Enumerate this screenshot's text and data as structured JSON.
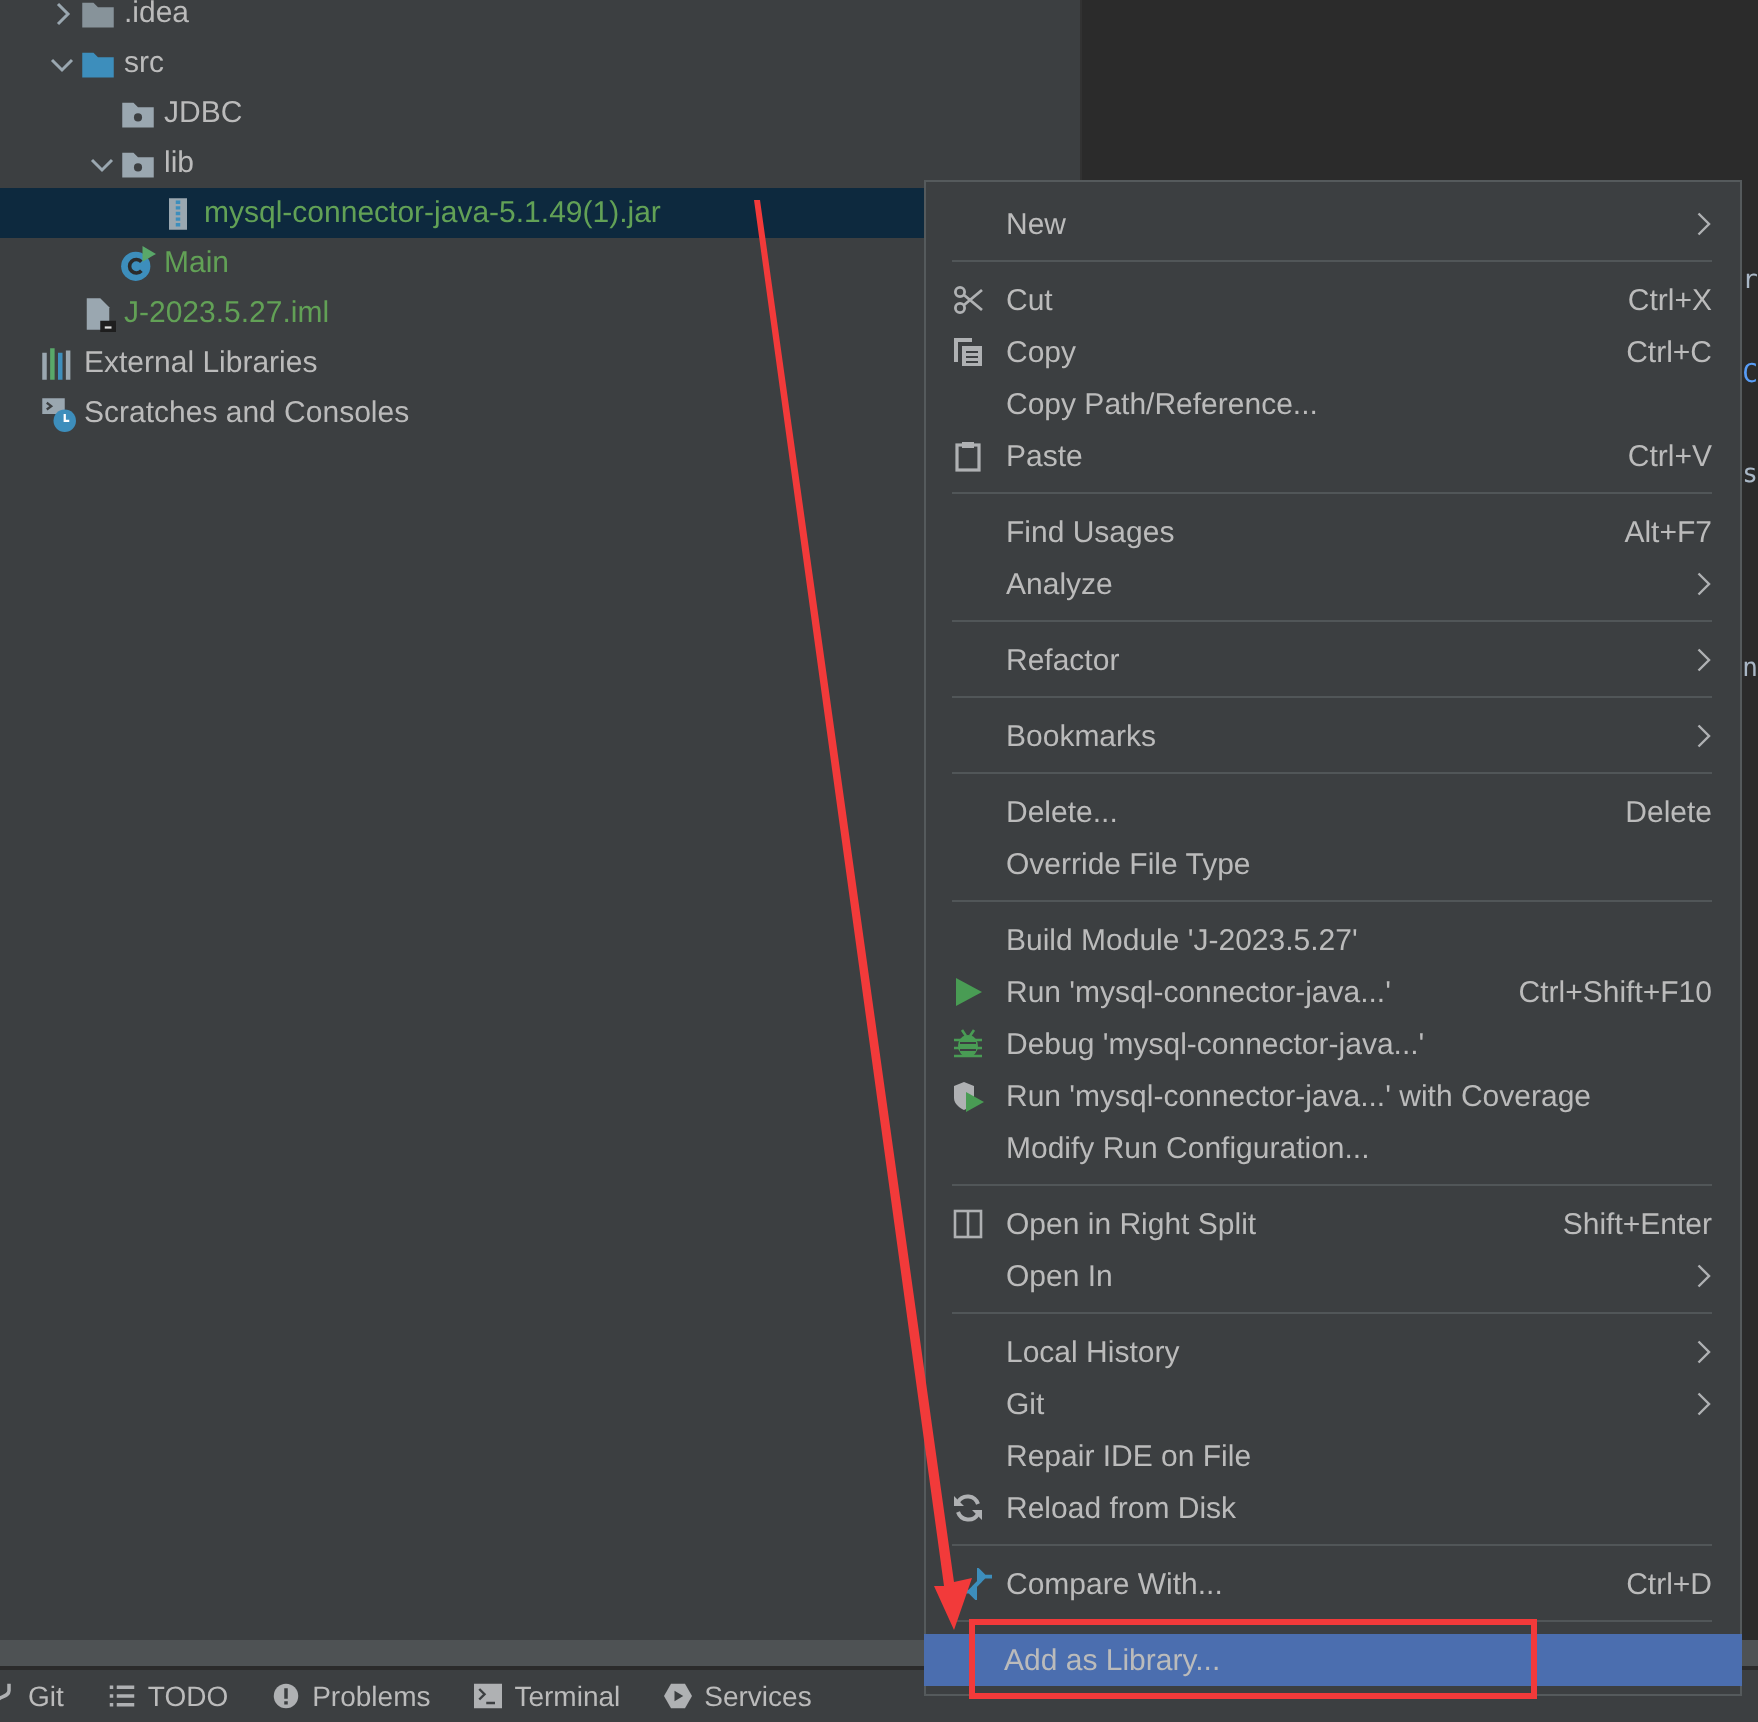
{
  "project_tree": [
    {
      "children": [
        {
          "label": ".idea",
          "kind": "folder",
          "expanded": false,
          "color": "#bbbbbb",
          "selected": false
        },
        {
          "label": "src",
          "kind": "source-root",
          "expanded": true,
          "color": "#bbbbbb",
          "selected": false,
          "children": [
            {
              "label": "JDBC",
              "kind": "package",
              "color": "#bbbbbb",
              "selected": false
            },
            {
              "label": "lib",
              "kind": "package",
              "expanded": true,
              "color": "#bbbbbb",
              "selected": false,
              "children": [
                {
                  "label": "mysql-connector-java-5.1.49(1).jar",
                  "kind": "jar",
                  "color": "#62a156",
                  "selected": true
                }
              ]
            },
            {
              "label": "Main",
              "kind": "class",
              "color": "#62a156",
              "selected": false
            }
          ]
        },
        {
          "label": "J-2023.5.27.iml",
          "kind": "module-file",
          "color": "#62a156",
          "selected": false
        }
      ]
    },
    {
      "label": "External Libraries",
      "kind": "libraries",
      "color": "#bbbbbb",
      "selected": false
    },
    {
      "label": "Scratches and Consoles",
      "kind": "scratches",
      "color": "#bbbbbb",
      "selected": false
    }
  ],
  "editor": {
    "fragments": [
      {
        "text": "r",
        "color": "#a9b7c6"
      },
      {
        "text": "C",
        "color": "#589df6"
      },
      {
        "text": "s",
        "color": "#a9b7c6"
      },
      {
        "text": "n",
        "color": "#a9b7c6"
      }
    ]
  },
  "context_menu": {
    "groups": [
      [
        {
          "label": "New",
          "kind": "plain",
          "submenu": true,
          "selected": false
        }
      ],
      [
        {
          "label": "Cut",
          "kind": "scissors",
          "shortcut": "Ctrl+X",
          "selected": false
        },
        {
          "label": "Copy",
          "kind": "copy",
          "shortcut": "Ctrl+C",
          "selected": false
        },
        {
          "label": "Copy Path/Reference...",
          "kind": "plain",
          "selected": false
        },
        {
          "label": "Paste",
          "kind": "paste",
          "shortcut": "Ctrl+V",
          "selected": false
        }
      ],
      [
        {
          "label": "Find Usages",
          "kind": "plain",
          "shortcut": "Alt+F7",
          "selected": false
        },
        {
          "label": "Analyze",
          "kind": "plain",
          "submenu": true,
          "selected": false
        }
      ],
      [
        {
          "label": "Refactor",
          "kind": "plain",
          "submenu": true,
          "selected": false
        }
      ],
      [
        {
          "label": "Bookmarks",
          "kind": "plain",
          "submenu": true,
          "selected": false
        }
      ],
      [
        {
          "label": "Delete...",
          "kind": "plain",
          "shortcut": "Delete",
          "selected": false
        },
        {
          "label": "Override File Type",
          "kind": "plain",
          "selected": false
        }
      ],
      [
        {
          "label": "Build Module 'J-2023.5.27'",
          "kind": "plain",
          "selected": false
        },
        {
          "label": "Run 'mysql-connector-java...'",
          "kind": "run",
          "shortcut": "Ctrl+Shift+F10",
          "selected": false
        },
        {
          "label": "Debug 'mysql-connector-java...'",
          "kind": "debug",
          "selected": false
        },
        {
          "label": "Run 'mysql-connector-java...' with Coverage",
          "kind": "coverage",
          "selected": false
        },
        {
          "label": "Modify Run Configuration...",
          "kind": "plain",
          "selected": false
        }
      ],
      [
        {
          "label": "Open in Right Split",
          "kind": "split",
          "shortcut": "Shift+Enter",
          "selected": false
        },
        {
          "label": "Open In",
          "kind": "plain",
          "submenu": true,
          "selected": false
        }
      ],
      [
        {
          "label": "Local History",
          "kind": "plain",
          "submenu": true,
          "selected": false
        },
        {
          "label": "Git",
          "kind": "plain",
          "submenu": true,
          "selected": false
        },
        {
          "label": "Repair IDE on File",
          "kind": "plain",
          "selected": false
        },
        {
          "label": "Reload from Disk",
          "kind": "reload",
          "selected": false
        }
      ],
      [
        {
          "label": "Compare With...",
          "kind": "compare",
          "shortcut": "Ctrl+D",
          "selected": false
        }
      ],
      [
        {
          "label": "Add as Library...",
          "kind": "plain",
          "selected": true
        }
      ]
    ]
  },
  "tool_window_bar": [
    {
      "label": "Git",
      "kind": "branch"
    },
    {
      "label": "TODO",
      "kind": "list"
    },
    {
      "label": "Problems",
      "kind": "alert"
    },
    {
      "label": "Terminal",
      "kind": "terminal"
    },
    {
      "label": "Services",
      "kind": "play"
    }
  ],
  "annotations": {
    "arrow": true,
    "highlight_box": true
  }
}
